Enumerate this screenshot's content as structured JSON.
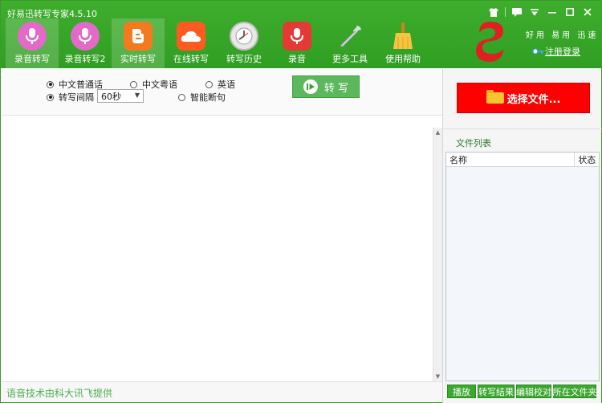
{
  "window": {
    "title": "好易迅转写专家4.5.10"
  },
  "toolbar": {
    "items": [
      {
        "label": "录音转写",
        "icon": "microphone-icon",
        "color": "#e36ac8",
        "active": true
      },
      {
        "label": "录音转写2",
        "icon": "microphone-icon",
        "color": "#e36ac8",
        "active": false
      },
      {
        "label": "实时转写",
        "icon": "blogger-icon",
        "color": "#f47a20",
        "active": true
      },
      {
        "label": "在线转写",
        "icon": "cloud-icon",
        "color": "#ff5a1f",
        "active": false
      },
      {
        "label": "转写历史",
        "icon": "clock-icon",
        "color": "#e8e8e8",
        "active": false
      },
      {
        "label": "录音",
        "icon": "record-mic-icon",
        "color": "#e53935",
        "active": false
      },
      {
        "label": "更多工具",
        "icon": "wrench-icon",
        "color": "#d8dde0",
        "active": false
      },
      {
        "label": "使用帮助",
        "icon": "broom-icon",
        "color": "#f5c542",
        "active": false
      }
    ]
  },
  "brand": {
    "slogan": "好用 易用 迅速",
    "register_label": "注册登录"
  },
  "options": {
    "lang_mandarin": "中文普通话",
    "lang_cantonese": "中文粤语",
    "lang_english": "英语",
    "interval_label": "转写间隔",
    "interval_value": "60秒",
    "smart_break": "智能断句",
    "transcribe_button": "转 写"
  },
  "right_panel": {
    "select_file_button": "选择文件...",
    "file_list_title": "文件列表",
    "columns": {
      "name": "名称",
      "status": "状态"
    },
    "actions": [
      "播放",
      "转写结果",
      "编辑校对",
      "所在文件夹"
    ]
  },
  "status_bar": {
    "text": "语音技术由科大讯飞提供"
  },
  "colors": {
    "header_green": "#3fae2e",
    "accent_red": "#ff0000",
    "status_green": "#4cae4c"
  }
}
